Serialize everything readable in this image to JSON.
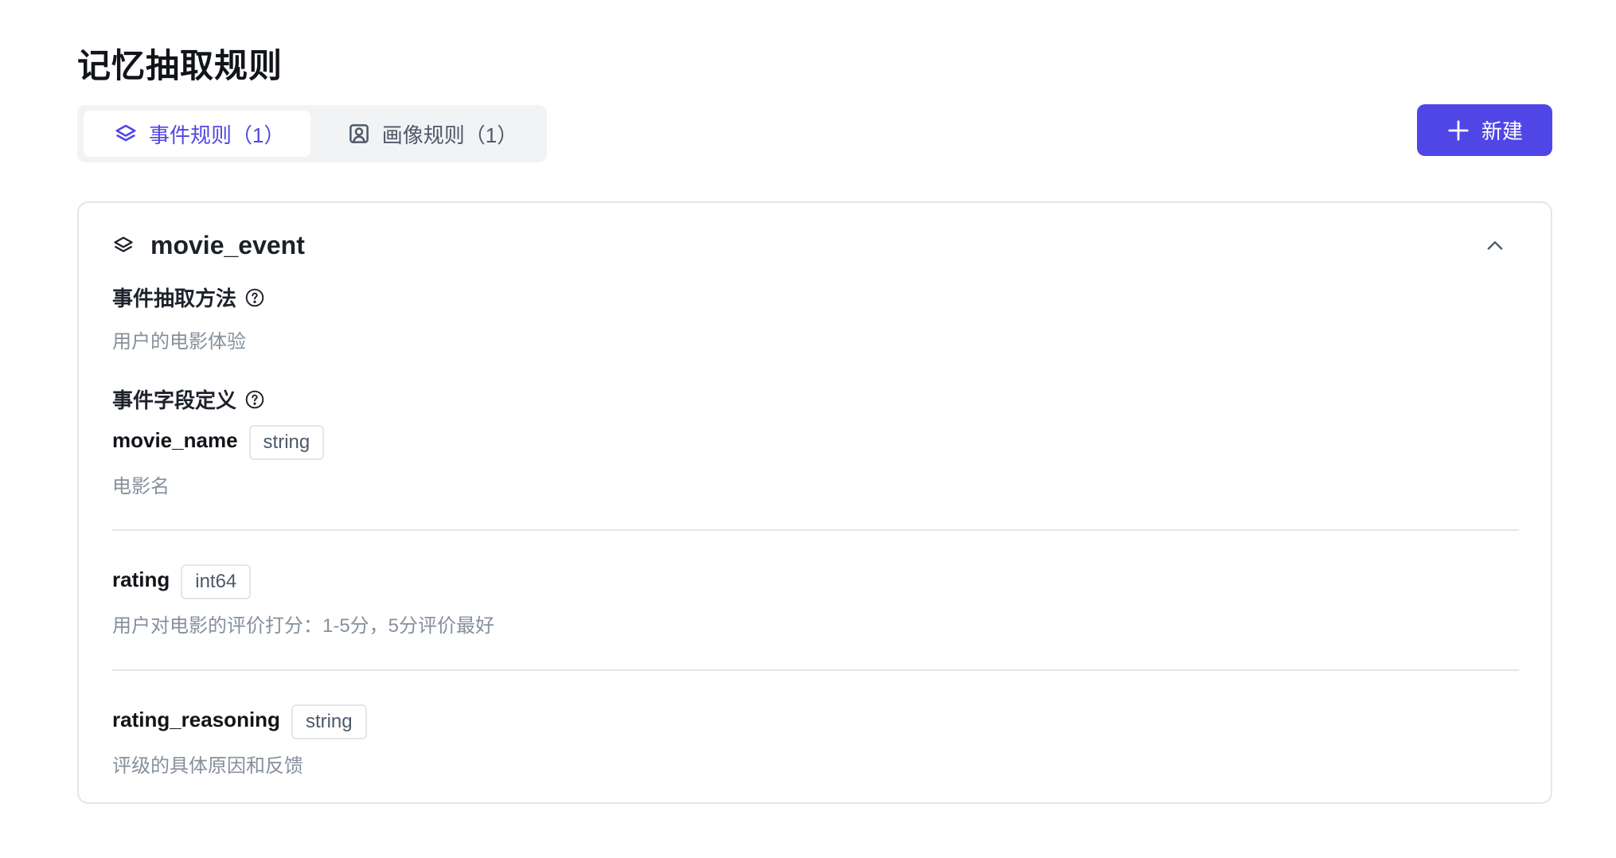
{
  "page": {
    "title": "记忆抽取规则"
  },
  "tabs": [
    {
      "label": "事件规则（1）",
      "icon": "layers-icon",
      "active": true
    },
    {
      "label": "画像规则（1）",
      "icon": "portrait-icon",
      "active": false
    }
  ],
  "toolbar": {
    "new_label": "新建"
  },
  "rule": {
    "name": "movie_event",
    "method_label": "事件抽取方法",
    "method_value": "用户的电影体验",
    "fields_label": "事件字段定义",
    "fields": [
      {
        "name": "movie_name",
        "type": "string",
        "description": "电影名"
      },
      {
        "name": "rating",
        "type": "int64",
        "description": "用户对电影的评价打分：1-5分，5分评价最好"
      },
      {
        "name": "rating_reasoning",
        "type": "string",
        "description": "评级的具体原因和反馈"
      }
    ]
  },
  "colors": {
    "accent": "#4f46e5",
    "border": "#e5e6eb",
    "muted": "#86909c"
  }
}
